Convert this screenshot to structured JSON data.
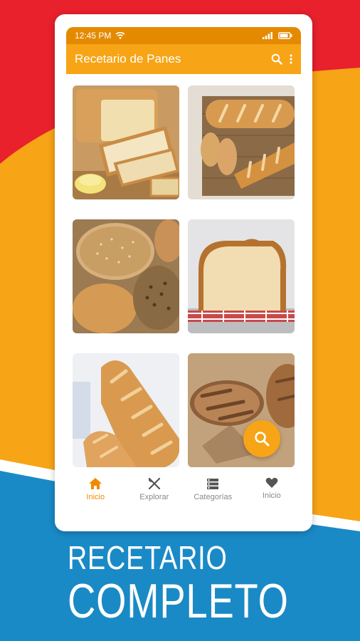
{
  "status_bar": {
    "time": "12:45 PM"
  },
  "app_bar": {
    "title": "Recetario de Panes"
  },
  "grid": {
    "images": [
      "sliced-white-bread",
      "baguettes-on-rack",
      "assorted-rolls",
      "sandwich-loaf",
      "french-loaves",
      "rustic-loaves"
    ]
  },
  "bottom_nav": {
    "items": [
      {
        "label": "Inicio",
        "icon": "home-icon",
        "active": true
      },
      {
        "label": "Explorar",
        "icon": "utensils-icon",
        "active": false
      },
      {
        "label": "Categorías",
        "icon": "list-icon",
        "active": false
      },
      {
        "label": "Inicio",
        "icon": "heart-icon",
        "active": false
      }
    ]
  },
  "promo": {
    "line1": "RECETARIO",
    "line2": "COMPLETO"
  },
  "colors": {
    "red": "#e8212d",
    "orange": "#f7a416",
    "blue": "#1a8ac6",
    "dark_orange": "#e48a00"
  }
}
